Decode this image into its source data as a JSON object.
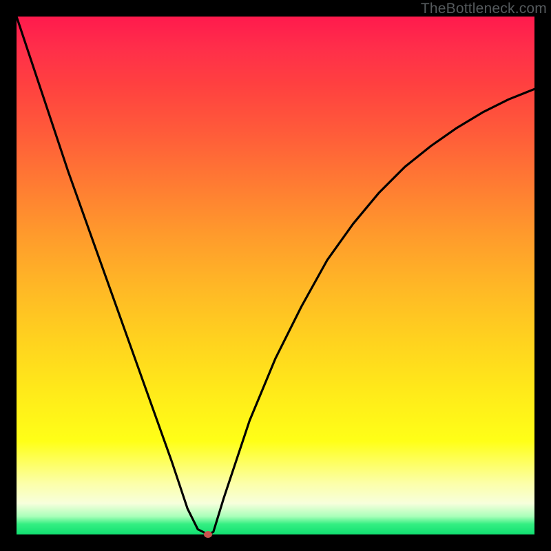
{
  "watermark": "TheBottleneck.com",
  "colors": {
    "gradient_top": "#ff1a4d",
    "gradient_mid": "#ffe91a",
    "gradient_bottom": "#11e071",
    "curve": "#000000",
    "dot": "#c9524e"
  },
  "chart_data": {
    "type": "line",
    "title": "",
    "xlabel": "",
    "ylabel": "",
    "xlim": [
      0,
      100
    ],
    "ylim": [
      0,
      100
    ],
    "series": [
      {
        "name": "bottleneck-curve",
        "x": [
          0,
          5,
          10,
          15,
          20,
          25,
          30,
          33,
          35,
          37,
          38,
          40,
          45,
          50,
          55,
          60,
          65,
          70,
          75,
          80,
          85,
          90,
          95,
          100
        ],
        "y": [
          100,
          85,
          70,
          56,
          42,
          28,
          14,
          5,
          1,
          0,
          0.5,
          7,
          22,
          34,
          44,
          53,
          60,
          66,
          71,
          75,
          78.5,
          81.5,
          84,
          86
        ]
      }
    ],
    "marker": {
      "x": 37,
      "y": 0,
      "name": "optimal-point"
    }
  }
}
